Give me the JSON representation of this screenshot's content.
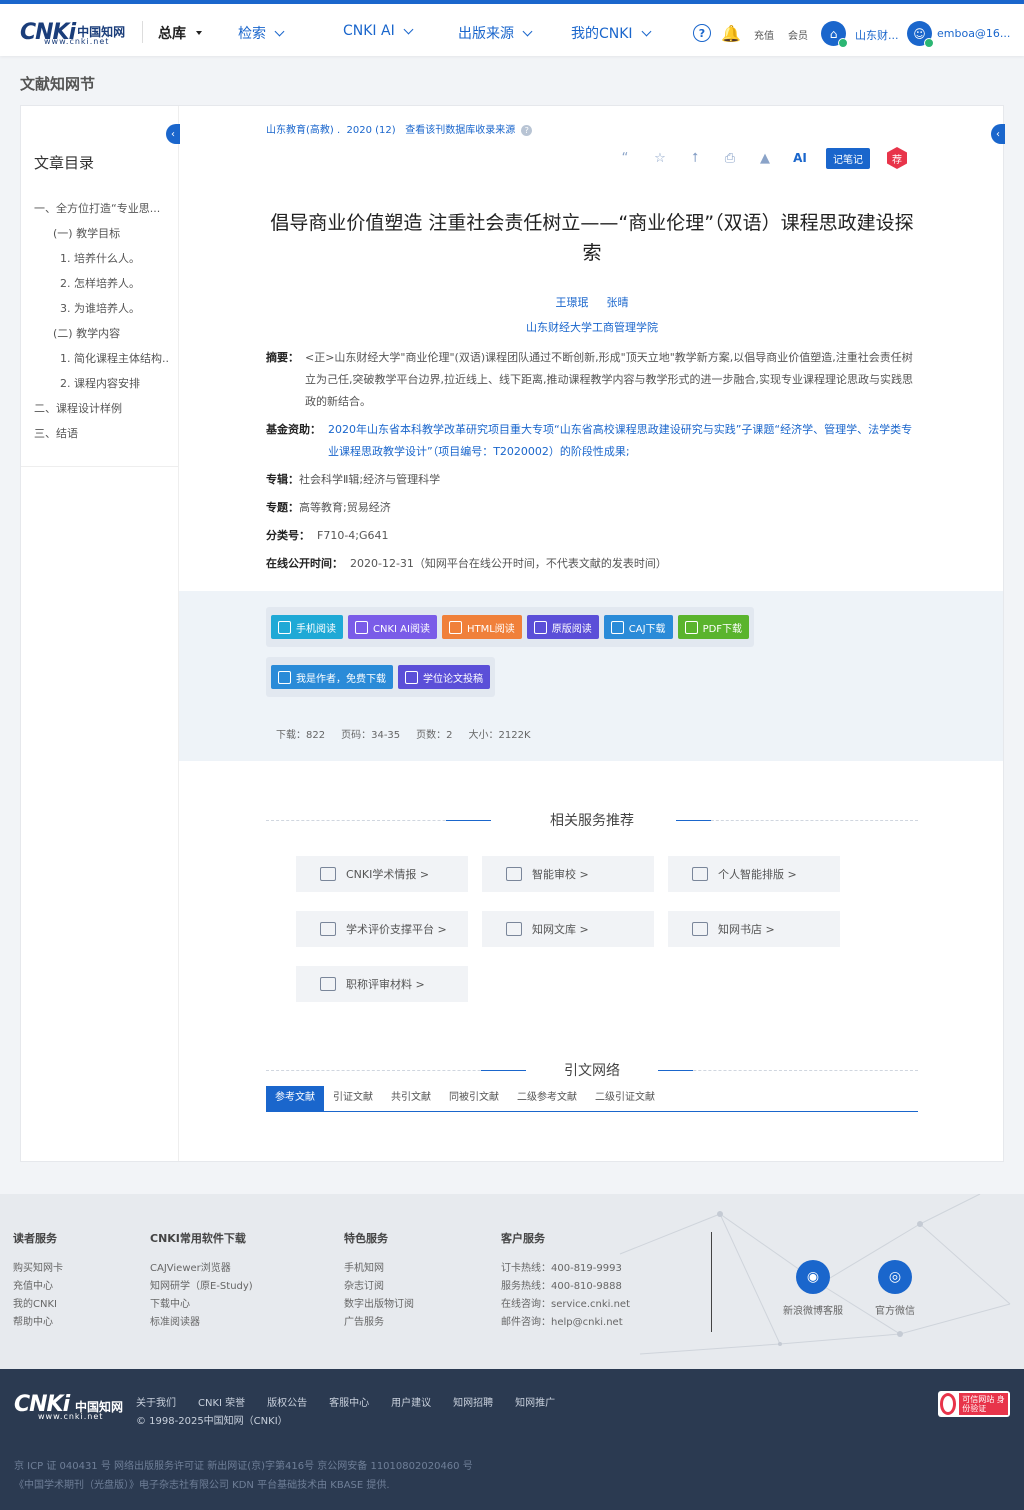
{
  "header": {
    "logo_text": "CNKi",
    "logo_cn": "中国知网",
    "logo_url": "www.cnki.net",
    "nav": [
      {
        "label": "总库"
      },
      {
        "label": "检索"
      },
      {
        "label": "CNKI AI"
      },
      {
        "label": "出版来源"
      },
      {
        "label": "我的CNKI"
      }
    ],
    "help_icon": "?",
    "recharge": "充值",
    "member": "会员",
    "institution": "山东财...",
    "user": "emboa@16..."
  },
  "page_title": "文献知网节",
  "toc": {
    "title": "文章目录",
    "items": [
      "一、全方位打造“专业思...",
      "(一) 教学目标",
      "1. 培养什么人。",
      "2. 怎样培养人。",
      "3. 为谁培养人。",
      "(二) 教学内容",
      "1. 简化课程主体结构...",
      "2. 课程内容安排",
      "二、课程设计样例",
      "三、结语"
    ]
  },
  "article": {
    "source": "山东教育(高教)",
    "issue": "2020 (12)",
    "db_link": "查看该刊数据库收录来源",
    "tools": {
      "note": "记笔记",
      "recommend": "荐",
      "ai": "AI"
    },
    "title": "倡导商业价值塑造 注重社会责任树立——“商业伦理”（双语）课程思政建设探索",
    "authors": [
      "王璟珉",
      "张晴"
    ],
    "institution": "山东财经大学工商管理学院",
    "abstract_label": "摘要：",
    "abstract": "<正>山东财经大学\"商业伦理\"(双语)课程团队通过不断创新,形成\"顶天立地\"教学新方案,以倡导商业价值塑造,注重社会责任树立为己任,突破教学平台边界,拉近线上、线下距离,推动课程教学内容与教学形式的进一步融合,实现专业课程理论思政与实践思政的新结合。",
    "fund_label": "基金资助：",
    "fund": "2020年山东省本科教学改革研究项目重大专项“山东省高校课程思政建设研究与实践”子课题“经济学、管理学、法学类专业课程思政教学设计”（项目编号：T2020002）的阶段性成果;",
    "series_label": "专辑：",
    "series": "社会科学Ⅱ辑;经济与管理科学",
    "topic_label": "专题：",
    "topic": "高等教育;贸易经济",
    "class_label": "分类号：",
    "class": "F710-4;G641",
    "pub_label": "在线公开时间：",
    "pub": "2020-12-31（知网平台在线公开时间，不代表文献的发表时间）"
  },
  "downloads": {
    "row1": [
      {
        "label": "手机阅读",
        "color": "#1fa9d6"
      },
      {
        "label": "CNKI AI阅读",
        "color": "#7a5ce8"
      },
      {
        "label": "HTML阅读",
        "color": "#f0803a"
      },
      {
        "label": "原版阅读",
        "color": "#5b4fd8"
      },
      {
        "label": "CAJ下载",
        "color": "#2a8bd8"
      },
      {
        "label": "PDF下载",
        "color": "#5ab42d"
      }
    ],
    "row2": [
      {
        "label": "我是作者，免费下载",
        "color": "#2a8bd8"
      },
      {
        "label": "学位论文投稿",
        "color": "#5b4fd8"
      }
    ],
    "stats": {
      "downloads": "下载：822",
      "pages_range": "页码：34-35",
      "page_count": "页数：2",
      "size": "大小：2122K"
    }
  },
  "services": {
    "title": "相关服务推荐",
    "items": [
      "CNKI学术情报 >",
      "智能审校 >",
      "个人智能排版 >",
      "学术评价支撑平台 >",
      "知网文库 >",
      "知网书店 >",
      "职称评审材料 >"
    ]
  },
  "citation": {
    "title": "引文网络",
    "tabs": [
      "参考文献",
      "引证文献",
      "共引文献",
      "同被引文献",
      "二级参考文献",
      "二级引证文献"
    ]
  },
  "footer": {
    "cols": [
      {
        "title": "读者服务",
        "links": [
          "购买知网卡",
          "充值中心",
          "我的CNKI",
          "帮助中心"
        ]
      },
      {
        "title": "CNKI常用软件下载",
        "links": [
          "CAJViewer浏览器",
          "知网研学（原E-Study)",
          "下载中心",
          "标准阅读器"
        ]
      },
      {
        "title": "特色服务",
        "links": [
          "手机知网",
          "杂志订阅",
          "数字出版物订阅",
          "广告服务"
        ]
      },
      {
        "title": "客户服务",
        "links": [
          "订卡热线：400-819-9993",
          "服务热线：400-810-9888",
          "在线咨询：service.cnki.net",
          "邮件咨询：help@cnki.net"
        ]
      }
    ],
    "weibo": "新浪微博客服",
    "wechat": "官方微信"
  },
  "bottom": {
    "links": [
      "关于我们",
      "CNKI 荣誉",
      "版权公告",
      "客服中心",
      "用户建议",
      "知网招聘",
      "知网推广"
    ],
    "copyright": "© 1998-2025中国知网（CNKI）",
    "badge": "可信网站 身份验证",
    "legal1": "京 ICP 证 040431 号  网络出版服务许可证 新出网证(京)字第416号  京公网安备 11010802020460 号",
    "legal2": "《中国学术期刊（光盘版）》电子杂志社有限公司  KDN 平台基础技术由 KBASE 提供."
  }
}
